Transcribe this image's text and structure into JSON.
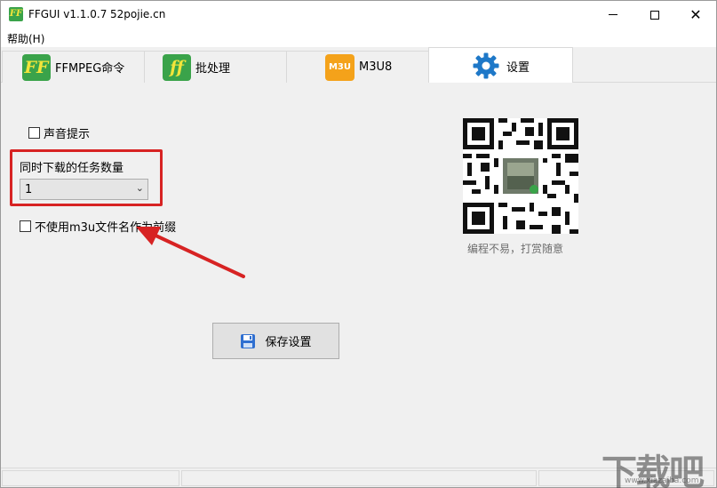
{
  "titlebar": {
    "icon_text": "FF",
    "title": "FFGUI v1.1.0.7",
    "site": "52pojie.cn"
  },
  "menubar": {
    "help": "帮助(H)"
  },
  "tabs": [
    {
      "icon": "ff-logo-icon",
      "icon_text": "FF",
      "label": "FFMPEG命令",
      "active": false
    },
    {
      "icon": "ff-logo-icon",
      "icon_text": "ff",
      "label": "批处理",
      "active": false
    },
    {
      "icon": "m3u-logo-icon",
      "icon_text": "M3U",
      "label": "M3U8",
      "active": false
    },
    {
      "icon": "gear-icon",
      "label": "设置",
      "active": true
    }
  ],
  "settings": {
    "sound_prompt": {
      "label": "声音提示",
      "checked": false
    },
    "concurrent_tasks_label": "同时下载的任务数量",
    "concurrent_tasks_value": "1",
    "no_m3u_prefix": {
      "label": "不使用m3u文件名作为前缀",
      "checked": false
    },
    "save_button": "保存设置",
    "qr_caption": "编程不易，打赏随意"
  },
  "watermark": {
    "text": "下载吧",
    "sub": "www.xiazaiba.com"
  },
  "colors": {
    "highlight": "#d72323",
    "ff_green": "#3aa34a",
    "ff_yellow": "#f3e53a",
    "m3u_orange": "#f4a21a",
    "gear_blue": "#1e78c8"
  }
}
